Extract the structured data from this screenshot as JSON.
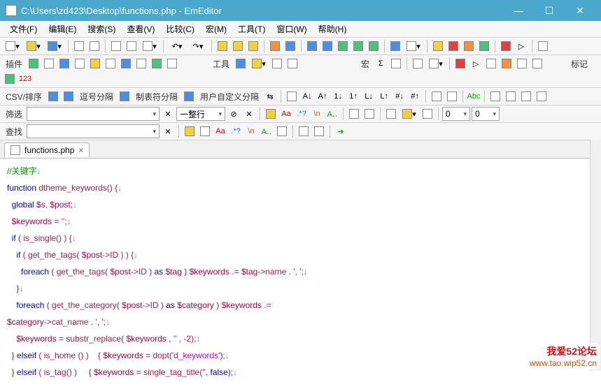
{
  "title": "C:\\Users\\zd423\\Desktop\\functions.php - EmEditor",
  "menu": [
    "文件(F)",
    "编辑(E)",
    "搜索(S)",
    "查看(V)",
    "比较(C)",
    "宏(M)",
    "工具(T)",
    "窗口(W)",
    "帮助(H)"
  ],
  "labels": {
    "plugin": "插件",
    "tools": "工具",
    "macro": "宏",
    "mark": "标记",
    "csv": "CSV/排序",
    "comma": "逗号分隔",
    "tabsep": "制表符分隔",
    "userdef": "用户自定义分隔",
    "filter": "筛选",
    "find": "查找",
    "wholeline": "一整行",
    "zero": "0"
  },
  "tab": {
    "name": "functions.php"
  },
  "code": [
    [
      {
        "c": "c-comment",
        "t": "//关键字"
      },
      {
        "c": "c-eol",
        "t": "↓"
      }
    ],
    [
      {
        "c": "c-kw",
        "t": "function"
      },
      {
        "t": " "
      },
      {
        "c": "c-fn",
        "t": "dtheme_keywords"
      },
      {
        "c": "c-punc",
        "t": "() {"
      },
      {
        "c": "c-eol",
        "t": "↓"
      }
    ],
    [
      {
        "t": "  "
      },
      {
        "c": "c-kw",
        "t": "global"
      },
      {
        "t": " "
      },
      {
        "c": "c-var",
        "t": "$s"
      },
      {
        "c": "c-punc",
        "t": ", "
      },
      {
        "c": "c-var",
        "t": "$post"
      },
      {
        "c": "c-punc",
        "t": ";"
      },
      {
        "c": "c-eol",
        "t": "↓"
      }
    ],
    [
      {
        "t": "  "
      },
      {
        "c": "c-var",
        "t": "$keywords"
      },
      {
        "c": "c-punc",
        "t": " = "
      },
      {
        "c": "c-str",
        "t": "''"
      },
      {
        "c": "c-punc",
        "t": ";"
      },
      {
        "c": "c-eol",
        "t": "↓"
      }
    ],
    [
      {
        "t": "  "
      },
      {
        "c": "c-kw",
        "t": "if"
      },
      {
        "c": "c-punc",
        "t": " ( "
      },
      {
        "c": "c-fn",
        "t": "is_single"
      },
      {
        "c": "c-punc",
        "t": "() ) {"
      },
      {
        "c": "c-eol",
        "t": "↓"
      }
    ],
    [
      {
        "t": "    "
      },
      {
        "c": "c-kw",
        "t": "if"
      },
      {
        "c": "c-punc",
        "t": " ( "
      },
      {
        "c": "c-fn",
        "t": "get_the_tags"
      },
      {
        "c": "c-punc",
        "t": "( "
      },
      {
        "c": "c-var",
        "t": "$post"
      },
      {
        "c": "c-punc",
        "t": "->ID ) ) {"
      },
      {
        "c": "c-eol",
        "t": "↓"
      }
    ],
    [
      {
        "t": "      "
      },
      {
        "c": "c-kw",
        "t": "foreach"
      },
      {
        "c": "c-punc",
        "t": " ( "
      },
      {
        "c": "c-fn",
        "t": "get_the_tags"
      },
      {
        "c": "c-punc",
        "t": "( "
      },
      {
        "c": "c-var",
        "t": "$post"
      },
      {
        "c": "c-punc",
        "t": "->ID ) "
      },
      {
        "c": "c-kw",
        "t": "as"
      },
      {
        "t": " "
      },
      {
        "c": "c-var",
        "t": "$tag"
      },
      {
        "c": "c-punc",
        "t": " ) "
      },
      {
        "c": "c-var",
        "t": "$keywords"
      },
      {
        "c": "c-punc",
        "t": " .= "
      },
      {
        "c": "c-var",
        "t": "$tag"
      },
      {
        "c": "c-punc",
        "t": "->name . "
      },
      {
        "c": "c-str",
        "t": "', '"
      },
      {
        "c": "c-punc",
        "t": ";"
      },
      {
        "c": "c-eol",
        "t": "↓"
      }
    ],
    [
      {
        "t": "    "
      },
      {
        "c": "c-punc",
        "t": "}"
      },
      {
        "c": "c-eol",
        "t": "↓"
      }
    ],
    [
      {
        "t": "    "
      },
      {
        "c": "c-kw",
        "t": "foreach"
      },
      {
        "c": "c-punc",
        "t": " ( "
      },
      {
        "c": "c-fn",
        "t": "get_the_category"
      },
      {
        "c": "c-punc",
        "t": "( "
      },
      {
        "c": "c-var",
        "t": "$post"
      },
      {
        "c": "c-punc",
        "t": "->ID ) "
      },
      {
        "c": "c-kw",
        "t": "as"
      },
      {
        "t": " "
      },
      {
        "c": "c-var",
        "t": "$category"
      },
      {
        "c": "c-punc",
        "t": " ) "
      },
      {
        "c": "c-var",
        "t": "$keywords"
      },
      {
        "c": "c-punc",
        "t": " .= "
      }
    ],
    [
      {
        "c": "c-var",
        "t": "$category"
      },
      {
        "c": "c-punc",
        "t": "->cat_name . "
      },
      {
        "c": "c-str",
        "t": "', '"
      },
      {
        "c": "c-punc",
        "t": ";"
      },
      {
        "c": "c-eol",
        "t": "↓"
      }
    ],
    [
      {
        "t": "    "
      },
      {
        "c": "c-var",
        "t": "$keywords"
      },
      {
        "c": "c-punc",
        "t": " = "
      },
      {
        "c": "c-fn",
        "t": "substr_replace"
      },
      {
        "c": "c-punc",
        "t": "( "
      },
      {
        "c": "c-var",
        "t": "$keywords"
      },
      {
        "c": "c-punc",
        "t": " , "
      },
      {
        "c": "c-str",
        "t": "''"
      },
      {
        "c": "c-punc",
        "t": " , -2);"
      },
      {
        "c": "c-eol",
        "t": "↓"
      }
    ],
    [
      {
        "t": "  "
      },
      {
        "c": "c-punc",
        "t": "} "
      },
      {
        "c": "c-kw",
        "t": "elseif"
      },
      {
        "c": "c-punc",
        "t": " ( "
      },
      {
        "c": "c-fn",
        "t": "is_home"
      },
      {
        "c": "c-punc",
        "t": " () )    { "
      },
      {
        "c": "c-var",
        "t": "$keywords"
      },
      {
        "c": "c-punc",
        "t": " = "
      },
      {
        "c": "c-fn",
        "t": "dopt"
      },
      {
        "c": "c-punc",
        "t": "("
      },
      {
        "c": "c-str",
        "t": "'d_keywords'"
      },
      {
        "c": "c-punc",
        "t": ");"
      },
      {
        "c": "c-eol",
        "t": "↓"
      }
    ],
    [
      {
        "t": "  "
      },
      {
        "c": "c-punc",
        "t": "} "
      },
      {
        "c": "c-kw",
        "t": "elseif"
      },
      {
        "c": "c-punc",
        "t": " ( "
      },
      {
        "c": "c-fn",
        "t": "is_tag"
      },
      {
        "c": "c-punc",
        "t": "() )     { "
      },
      {
        "c": "c-var",
        "t": "$keywords"
      },
      {
        "c": "c-punc",
        "t": " = "
      },
      {
        "c": "c-fn",
        "t": "single_tag_title"
      },
      {
        "c": "c-punc",
        "t": "("
      },
      {
        "c": "c-str",
        "t": "''"
      },
      {
        "c": "c-punc",
        "t": ", "
      },
      {
        "c": "c-kw",
        "t": "false"
      },
      {
        "c": "c-punc",
        "t": ");"
      },
      {
        "c": "c-eol",
        "t": "↓"
      }
    ]
  ],
  "watermark": {
    "big": "我爱52论坛",
    "url": "www.tao.wip52.cn"
  }
}
